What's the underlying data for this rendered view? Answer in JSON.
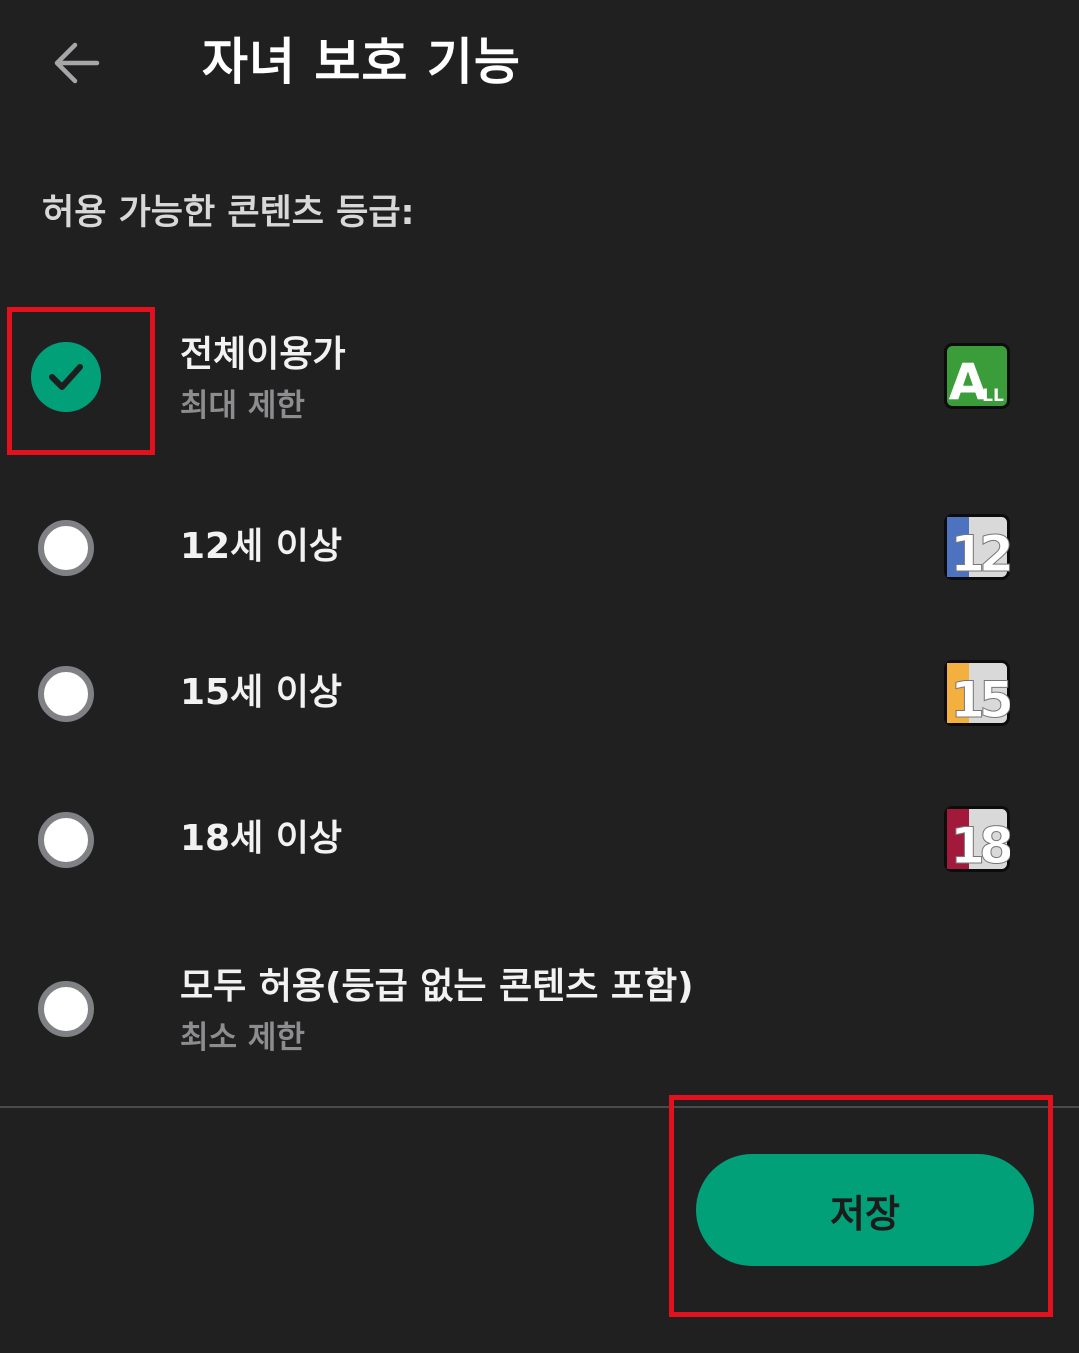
{
  "header": {
    "title": "자녀 보호 기능",
    "back_icon": "arrow-left-icon"
  },
  "section_label": "허용 가능한 콘텐츠 등급:",
  "options": [
    {
      "title": "전체이용가",
      "subtitle": "최대 제한",
      "selected": true,
      "badge_icon": "rating-all-icon"
    },
    {
      "title": "12세 이상",
      "selected": false,
      "badge_icon": "rating-12-icon"
    },
    {
      "title": "15세 이상",
      "selected": false,
      "badge_icon": "rating-15-icon"
    },
    {
      "title": "18세 이상",
      "selected": false,
      "badge_icon": "rating-18-icon"
    },
    {
      "title": "모두 허용(등급 없는 콘텐츠 포함)",
      "subtitle": "최소 제한",
      "selected": false
    }
  ],
  "badges": {
    "all": {
      "letter": "A",
      "small": "LL"
    },
    "r12": {
      "label": "12"
    },
    "r15": {
      "label": "15"
    },
    "r18": {
      "label": "18"
    }
  },
  "save_button": {
    "label": "저장"
  },
  "colors": {
    "background": "#202021",
    "accent": "#02a079",
    "highlight": "#e3111e",
    "badge_all": "#3b9c3a",
    "badge_12": "#4d72bf",
    "badge_15": "#f4b03e",
    "badge_18": "#a3193c"
  }
}
